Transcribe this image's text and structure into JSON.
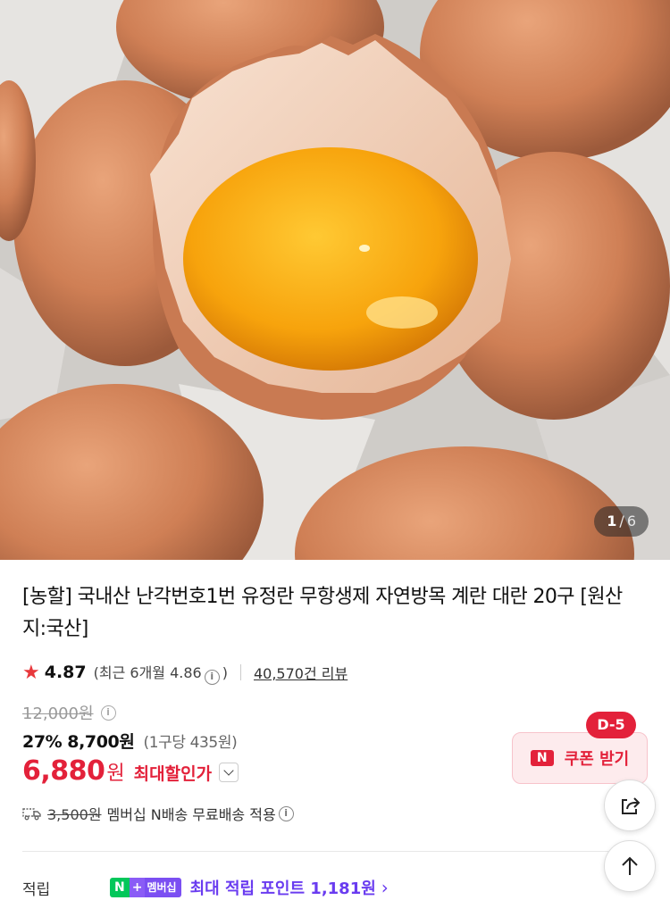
{
  "gallery": {
    "current": "1",
    "separator": "/",
    "total": "6"
  },
  "product": {
    "title": "[농할] 국내산 난각번호1번 유정란 무항생제 자연방목 계란 대란 20구 [원산지:국산]",
    "rating": "4.87",
    "recent_rating_prefix": "(최근 6개월 4.86",
    "recent_rating_suffix": ")",
    "review_count": "40,570건 리뷰"
  },
  "price": {
    "original": "12,000원",
    "discount_rate": "27%",
    "discounted": "8,700원",
    "unit_price": "(1구당 435원)",
    "max_discount_price": "6,880",
    "max_discount_won": "원",
    "max_discount_label": "최대할인가"
  },
  "coupon": {
    "dday": "D-5",
    "n_mark": "N",
    "label": "쿠폰 받기"
  },
  "shipping": {
    "original_fee": "3,500원",
    "note": "멤버십 N배송 무료배송 적용"
  },
  "points": {
    "label": "적립",
    "badge_n": "N",
    "badge_plus": "+",
    "badge_membership": "멤버십",
    "text": "최대 적립 포인트 1,181원",
    "arrow": "›"
  },
  "colors": {
    "accent_red": "#e3213a",
    "membership_purple": "#6a3cf0",
    "naver_green": "#03c75a"
  },
  "icons": [
    "star-icon",
    "info-icon",
    "chevron-down-icon",
    "truck-icon",
    "share-icon",
    "arrow-up-icon",
    "chevron-right-icon"
  ]
}
